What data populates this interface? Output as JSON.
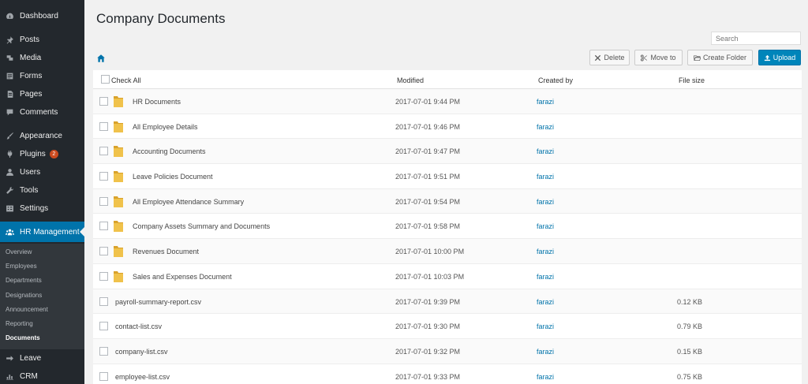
{
  "sidebar": {
    "items": [
      {
        "label": "Dashboard",
        "icon": "dashboard-icon"
      },
      {
        "label": "Posts",
        "icon": "pin-icon"
      },
      {
        "label": "Media",
        "icon": "media-icon"
      },
      {
        "label": "Forms",
        "icon": "forms-icon"
      },
      {
        "label": "Pages",
        "icon": "pages-icon"
      },
      {
        "label": "Comments",
        "icon": "comment-icon"
      },
      {
        "label": "Appearance",
        "icon": "brush-icon"
      },
      {
        "label": "Plugins",
        "icon": "plugin-icon",
        "badge": "2"
      },
      {
        "label": "Users",
        "icon": "user-icon"
      },
      {
        "label": "Tools",
        "icon": "wrench-icon"
      },
      {
        "label": "Settings",
        "icon": "settings-icon"
      },
      {
        "label": "HR Management",
        "icon": "groups-icon"
      },
      {
        "label": "Leave",
        "icon": "arrow-right-icon"
      },
      {
        "label": "CRM",
        "icon": "chart-icon"
      }
    ],
    "submenu": [
      "Overview",
      "Employees",
      "Departments",
      "Designations",
      "Announcement",
      "Reporting",
      "Documents"
    ]
  },
  "main": {
    "title": "Company Documents",
    "search_placeholder": "Search",
    "toolbar": {
      "delete": "Delete",
      "move": "Move to",
      "create_folder": "Create Folder",
      "upload": "Upload"
    },
    "table": {
      "headers": {
        "check_all": "Check All",
        "modified": "Modified",
        "created_by": "Created by",
        "file_size": "File size"
      },
      "rows": [
        {
          "name": "HR Documents",
          "modified": "2017-07-01 9:44 PM",
          "by": "farazi",
          "size": "",
          "folder": true
        },
        {
          "name": "All Employee Details",
          "modified": "2017-07-01 9:46 PM",
          "by": "farazi",
          "size": "",
          "folder": true
        },
        {
          "name": "Accounting Documents",
          "modified": "2017-07-01 9:47 PM",
          "by": "farazi",
          "size": "",
          "folder": true
        },
        {
          "name": "Leave Policies Document",
          "modified": "2017-07-01 9:51 PM",
          "by": "farazi",
          "size": "",
          "folder": true
        },
        {
          "name": "All Employee Attendance Summary",
          "modified": "2017-07-01 9:54 PM",
          "by": "farazi",
          "size": "",
          "folder": true
        },
        {
          "name": "Company Assets Summary and Documents",
          "modified": "2017-07-01 9:58 PM",
          "by": "farazi",
          "size": "",
          "folder": true
        },
        {
          "name": "Revenues Document",
          "modified": "2017-07-01 10:00 PM",
          "by": "farazi",
          "size": "",
          "folder": true
        },
        {
          "name": "Sales and Expenses Document",
          "modified": "2017-07-01 10:03 PM",
          "by": "farazi",
          "size": "",
          "folder": true
        },
        {
          "name": "payroll-summary-report.csv",
          "modified": "2017-07-01 9:39 PM",
          "by": "farazi",
          "size": "0.12 KB",
          "folder": false
        },
        {
          "name": "contact-list.csv",
          "modified": "2017-07-01 9:30 PM",
          "by": "farazi",
          "size": "0.79 KB",
          "folder": false
        },
        {
          "name": "company-list.csv",
          "modified": "2017-07-01 9:32 PM",
          "by": "farazi",
          "size": "0.15 KB",
          "folder": false
        },
        {
          "name": "employee-list.csv",
          "modified": "2017-07-01 9:33 PM",
          "by": "farazi",
          "size": "0.75 KB",
          "folder": false
        }
      ]
    }
  },
  "colors": {
    "accent": "#0073aa",
    "sidebar_bg": "#23282d",
    "submenu_bg": "#32373c",
    "badge": "#ca4a1f",
    "folder": "#e8b93f"
  }
}
